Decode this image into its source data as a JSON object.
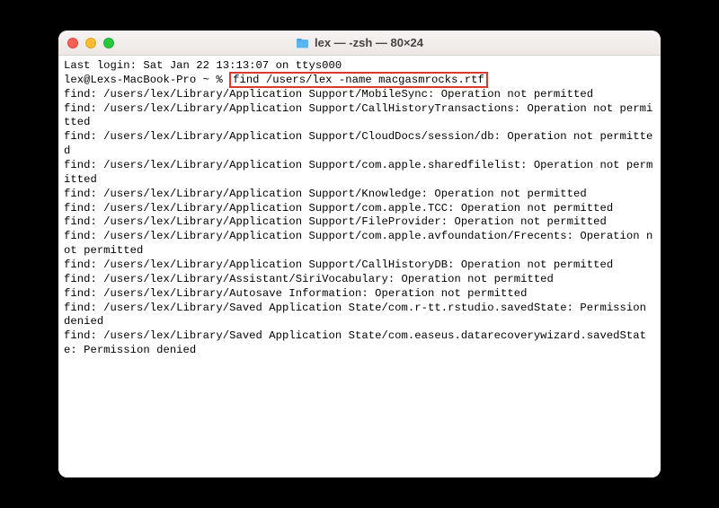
{
  "window": {
    "title": "lex — -zsh — 80×24",
    "icon": "folder-icon"
  },
  "terminal": {
    "last_login": "Last login: Sat Jan 22 13:13:07 on ttys000",
    "prompt": "lex@Lexs-MacBook-Pro ~ % ",
    "command": "find /users/lex -name macgasmrocks.rtf",
    "lines": [
      "find: /users/lex/Library/Application Support/MobileSync: Operation not permitted",
      "find: /users/lex/Library/Application Support/CallHistoryTransactions: Operation not permitted",
      "find: /users/lex/Library/Application Support/CloudDocs/session/db: Operation not permitted",
      "find: /users/lex/Library/Application Support/com.apple.sharedfilelist: Operation not permitted",
      "find: /users/lex/Library/Application Support/Knowledge: Operation not permitted",
      "find: /users/lex/Library/Application Support/com.apple.TCC: Operation not permitted",
      "find: /users/lex/Library/Application Support/FileProvider: Operation not permitted",
      "find: /users/lex/Library/Application Support/com.apple.avfoundation/Frecents: Operation not permitted",
      "find: /users/lex/Library/Application Support/CallHistoryDB: Operation not permitted",
      "find: /users/lex/Library/Assistant/SiriVocabulary: Operation not permitted",
      "find: /users/lex/Library/Autosave Information: Operation not permitted",
      "find: /users/lex/Library/Saved Application State/com.r-tt.rstudio.savedState: Permission denied",
      "find: /users/lex/Library/Saved Application State/com.easeus.datarecoverywizard.savedState: Permission denied"
    ]
  }
}
